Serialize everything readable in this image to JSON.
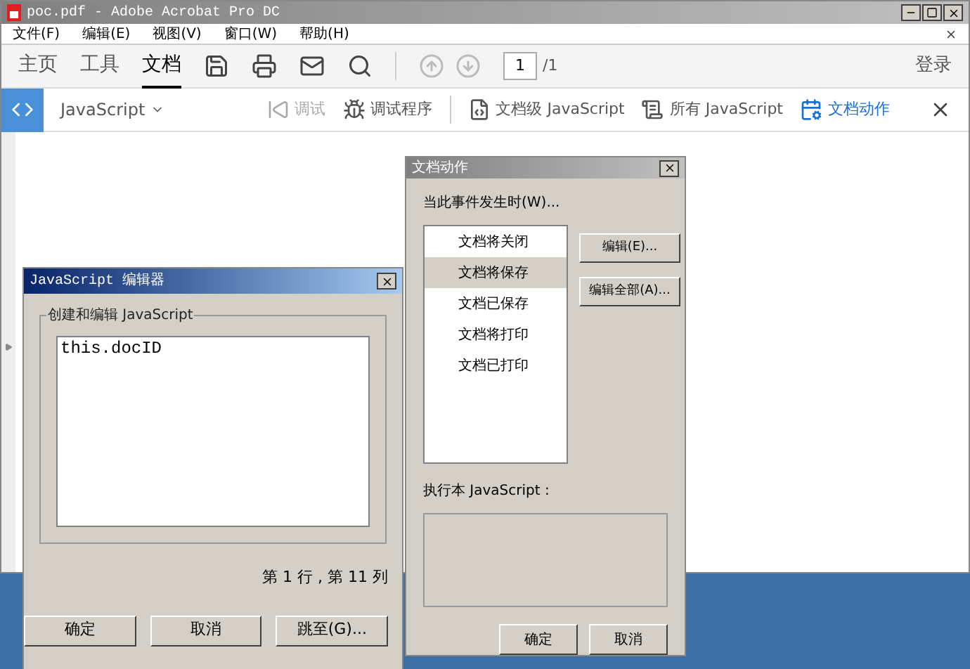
{
  "window": {
    "title": "poc.pdf - Adobe Acrobat Pro DC"
  },
  "menu": [
    "文件(F)",
    "编辑(E)",
    "视图(V)",
    "窗口(W)",
    "帮助(H)"
  ],
  "main_tabs": [
    {
      "label": "主页",
      "selected": false
    },
    {
      "label": "工具",
      "selected": false
    },
    {
      "label": "文档",
      "selected": true
    }
  ],
  "page_nav": {
    "page": "1",
    "total": "/1"
  },
  "login": "登录",
  "js_toolbar": {
    "dropdown": "JavaScript",
    "tools": [
      {
        "label": "调试",
        "kind": "debug",
        "disabled": true,
        "selected": false
      },
      {
        "label": "调试程序",
        "kind": "debugger",
        "disabled": false,
        "selected": false
      },
      {
        "label": "文档级 JavaScript",
        "kind": "doc-js",
        "disabled": false,
        "selected": false
      },
      {
        "label": "所有 JavaScript",
        "kind": "all-js",
        "disabled": false,
        "selected": false
      },
      {
        "label": "文档动作",
        "kind": "doc-actions",
        "disabled": false,
        "selected": true
      }
    ]
  },
  "js_editor": {
    "title": "JavaScript 编辑器",
    "group_label": "创建和编辑 JavaScript",
    "code": "this.docID",
    "position": "第 1 行 , 第 11 列",
    "buttons": [
      "确定",
      "取消",
      "跳至(G)..."
    ]
  },
  "doc_actions": {
    "title": "文档动作",
    "event_label": "当此事件发生时(W)...",
    "events": [
      {
        "label": "文档将关闭",
        "selected": false
      },
      {
        "label": "文档将保存",
        "selected": true
      },
      {
        "label": "文档已保存",
        "selected": false
      },
      {
        "label": "文档将打印",
        "selected": false
      },
      {
        "label": "文档已打印",
        "selected": false
      }
    ],
    "side_buttons": [
      "编辑(E)...",
      "编辑全部(A)..."
    ],
    "script_label": "执行本 JavaScript :",
    "buttons": [
      "确定",
      "取消"
    ]
  }
}
